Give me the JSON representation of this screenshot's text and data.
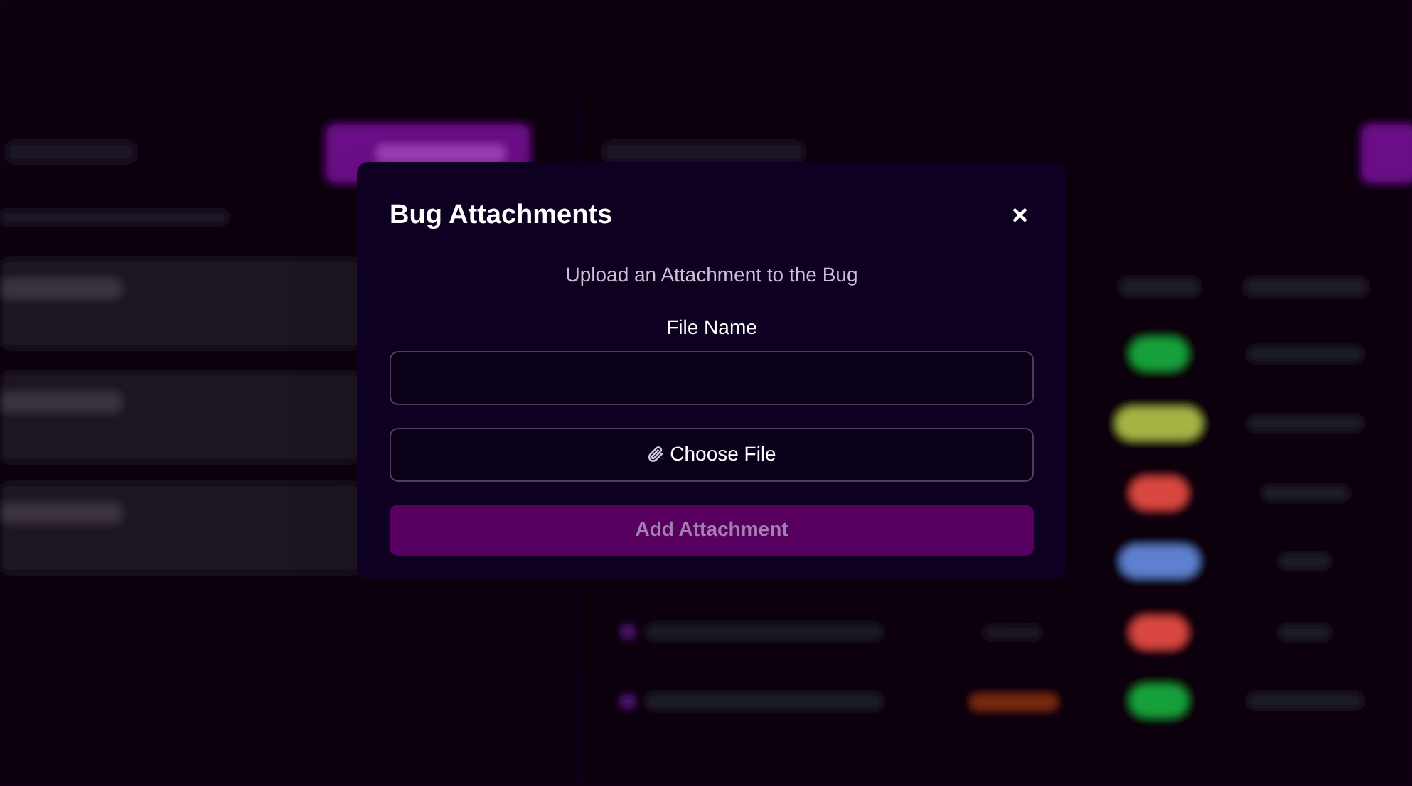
{
  "dialog": {
    "title": "Bug Attachments",
    "close_icon": "×",
    "subtitle": "Upload an Attachment to the Bug",
    "file_name": {
      "label": "File Name"
    },
    "choose_file": {
      "label": "Choose File"
    },
    "submit": {
      "label": "Add Attachment",
      "disabled": true
    }
  }
}
